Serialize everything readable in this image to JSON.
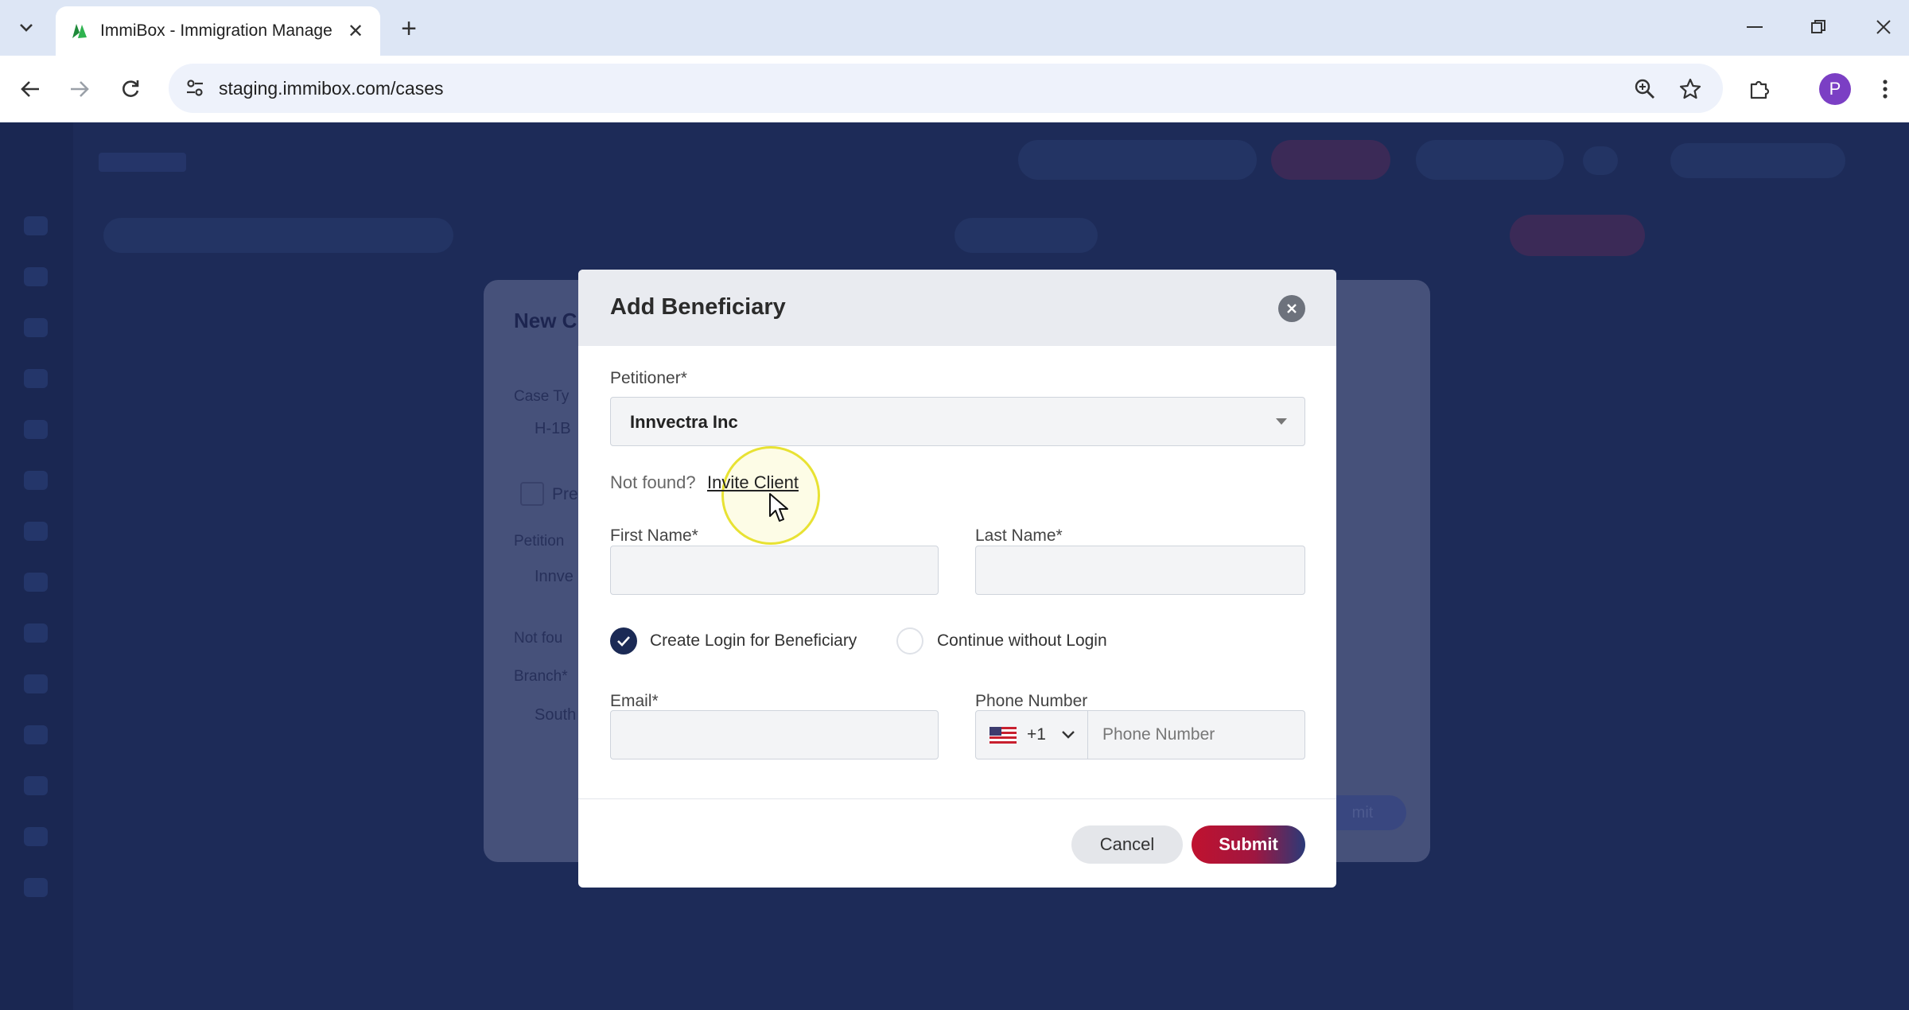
{
  "browser": {
    "tab_title": "ImmiBox - Immigration Manage",
    "url": "staging.immibox.com/cases",
    "profile_initial": "P"
  },
  "background_modal": {
    "title": "New C",
    "case_type_label": "Case Ty",
    "case_type_value": "H-1B",
    "checkbox_label": "Pre",
    "petitioner_label": "Petition",
    "petitioner_value": "Innve",
    "not_found": "Not fou",
    "branch_label": "Branch*",
    "branch_value": "South",
    "submit_label": "mit"
  },
  "modal": {
    "title": "Add Beneficiary",
    "petitioner": {
      "label": "Petitioner*",
      "value": "Innvectra Inc"
    },
    "not_found_text": "Not found?",
    "invite_link": "Invite Client",
    "first_name": {
      "label": "First Name*",
      "value": ""
    },
    "last_name": {
      "label": "Last Name*",
      "value": ""
    },
    "login_options": {
      "create_login": "Create Login for Beneficiary",
      "continue_without": "Continue without Login",
      "selected": "create_login"
    },
    "email": {
      "label": "Email*",
      "value": ""
    },
    "phone": {
      "label": "Phone Number",
      "dial_code": "+1",
      "placeholder": "Phone Number",
      "value": ""
    },
    "cancel_label": "Cancel",
    "submit_label": "Submit"
  },
  "colors": {
    "overlay": "#1d2b58",
    "primary_navy": "#1b2a55",
    "submit_red": "#c0122f"
  }
}
